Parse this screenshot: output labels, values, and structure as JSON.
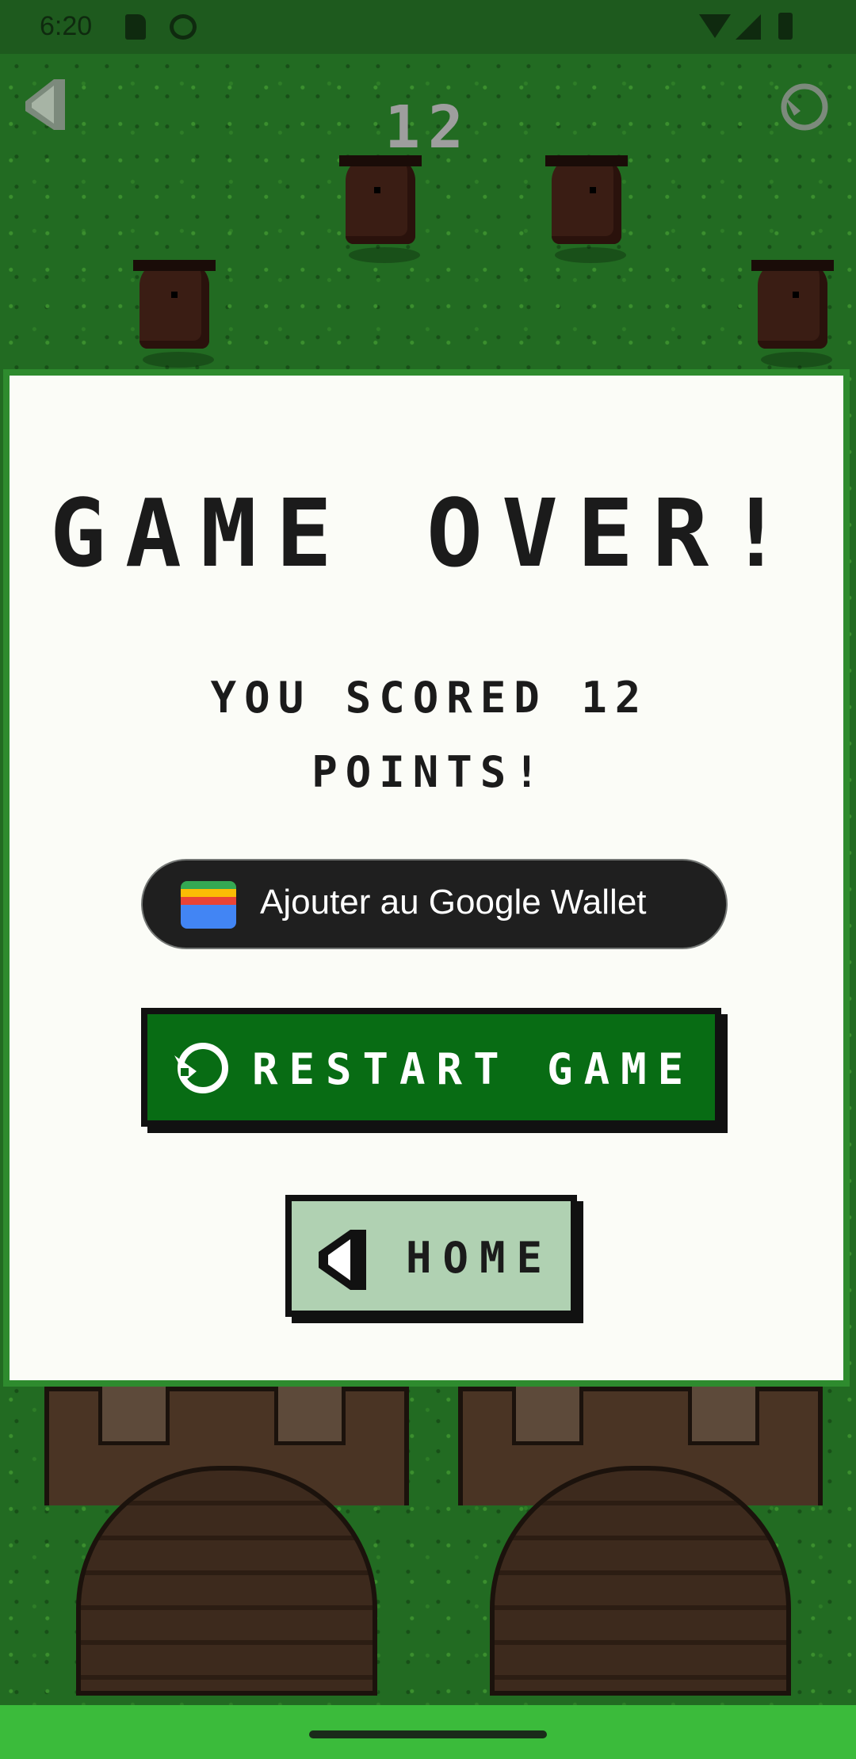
{
  "status_bar": {
    "time": "6:20",
    "icons": [
      "sd-card-icon",
      "android-icon",
      "wifi-icon",
      "signal-icon",
      "battery-icon"
    ]
  },
  "game": {
    "score": "12",
    "background_color": "#226b22"
  },
  "dialog": {
    "title": "GAME OVER!",
    "score_line1": "YOU SCORED 12",
    "score_line2": "POINTS!",
    "wallet_button": "Ajouter au Google Wallet",
    "restart_button": "RESTART GAME",
    "home_button": "HOME",
    "accent_color": "#086c14",
    "home_color": "#b0d1b2"
  }
}
